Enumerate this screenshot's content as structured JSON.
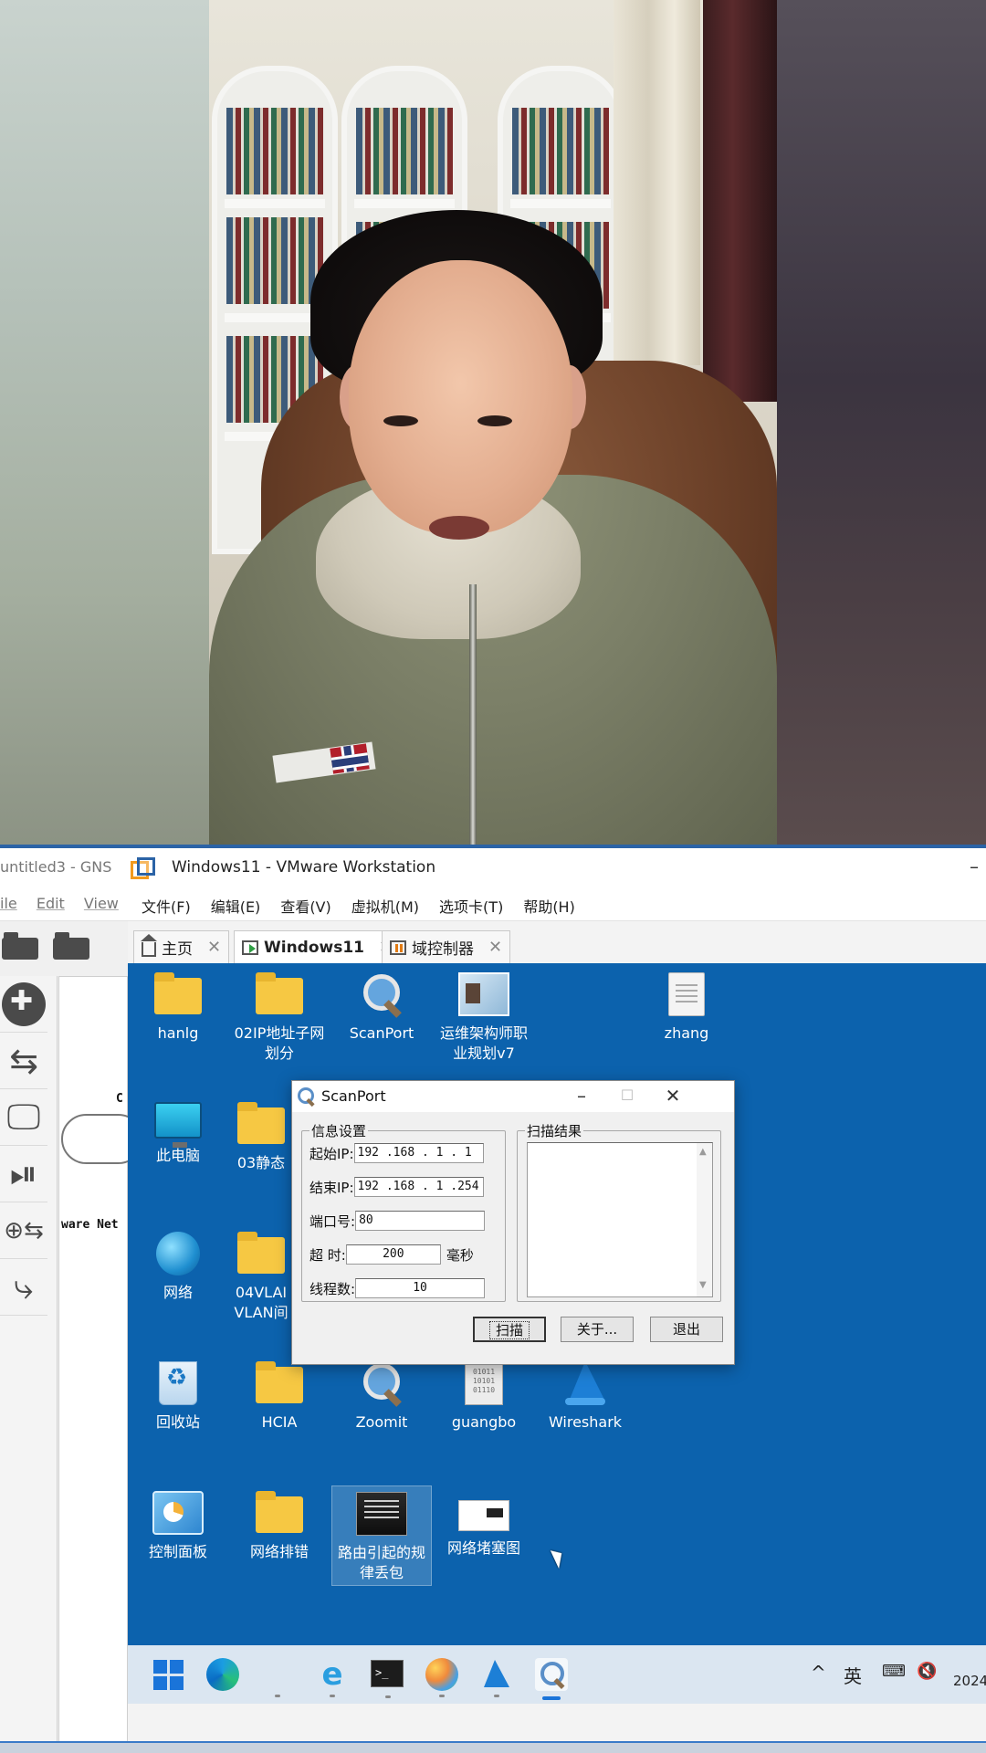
{
  "window": {
    "gns_title": "untitled3 - GNS",
    "vm_title": "Windows11 - VMware Workstation",
    "minimize_glyph": "–"
  },
  "gns_menu": [
    "ile",
    "Edit",
    "View"
  ],
  "vm_menu": [
    "文件(F)",
    "编辑(E)",
    "查看(V)",
    "虚拟机(M)",
    "选项卡(T)",
    "帮助(H)"
  ],
  "gns_canvas": {
    "label_c": "C",
    "label_net": "ware Net"
  },
  "tabs": [
    {
      "label": "主页",
      "icon": "home-icon",
      "close": "✕"
    },
    {
      "label": "Windows11",
      "icon": "vm-running-icon",
      "close": "✕"
    },
    {
      "label": "域控制器",
      "icon": "vm-paused-icon",
      "close": "✕"
    }
  ],
  "desktop_icons": {
    "hanlg": "hanlg",
    "ip_subnet": "02IP地址子网划分",
    "scanport": "ScanPort",
    "career": "运维架构师职业规划v7",
    "zhang": "zhang",
    "this_pc": "此电脑",
    "static_route": "03静态",
    "network": "网络",
    "vlan_1": "04VLAI",
    "vlan_2": "VLAN间",
    "recycle": "回收站",
    "hcia": "HCIA",
    "zoomit": "Zoomit",
    "guangbo": "guangbo",
    "wireshark": "Wireshark",
    "control_panel": "控制面板",
    "net_troubleshoot": "网络排错",
    "routing_loss": "路由引起的规律丢包",
    "net_congestion": "网络堵塞图"
  },
  "binary_text": "01011\n10101\n01110",
  "scanport": {
    "title": "ScanPort",
    "min": "–",
    "max": "☐",
    "close": "✕",
    "settings_label": "信息设置",
    "results_label": "扫描结果",
    "start_ip_label": "起始IP:",
    "start_ip": "192 .168 . 1  . 1",
    "end_ip_label": "结束IP:",
    "end_ip": "192 .168 . 1  .254",
    "port_label": "端口号:",
    "port": "80",
    "timeout_label": "超  时:",
    "timeout": "200",
    "timeout_unit": "毫秒",
    "threads_label": "线程数:",
    "threads": "10",
    "scroll_up": "▲",
    "scroll_down": "▼",
    "scan_button": "扫描",
    "about_button": "关于...",
    "exit_button": "退出"
  },
  "taskbar": {
    "tray_up": "^",
    "ime": "英",
    "clock": "2024"
  },
  "colors": {
    "desktop": "#0c62ad",
    "folder": "#f6c843",
    "accent": "#1a74d9"
  }
}
